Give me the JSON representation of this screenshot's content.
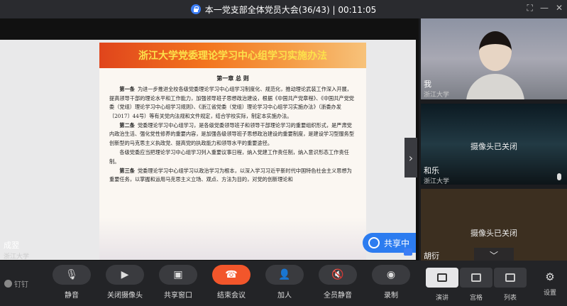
{
  "titlebar": {
    "title": "本一党支部全体党员大会(36/43) | 00:11:05"
  },
  "document": {
    "title": "浙江大学党委理论学习中心组学习实施办法",
    "chapter": "第一章 总 则",
    "paragraphs": [
      {
        "head": "第一条",
        "text": "为进一步推进全校各级党委理论学习中心组学习制度化、规范化，推动理论武装工作深入开展，提高领导干部的理论水平和工作能力，加强领导班子思想政治建设，根据《中国共产党章程》、《中国共产党党委（党组）理论学习中心组学习规则》、《浙江省党委（党组）理论学习中心组学习实施办法》（浙委办发〔2017〕44号）等有关党内法规和文件规定，结合学校实际，制定本实施办法。"
      },
      {
        "head": "第二条",
        "text": "党委理论学习中心组学习，是各级党委领导班子和领导干部理论学习的重要组织形式，是严肃党内政治生活、强化党性修养的重要内容，是加强各级领导班子思想政治建设的重要制度，是建设学习型服务型创新型的马克思主义执政党、提高党的执政能力和领导水平的重要途径。"
      },
      {
        "head": "",
        "text": "各级党委应当把理论学习中心组学习列入重要议事日程，纳入党建工作责任制，纳入意识形态工作责任制。"
      },
      {
        "head": "第三条",
        "text": "党委理论学习中心组学习以政治学习为根本，以深入学习习近平新时代中国特色社会主义思想为重要任务，以掌握和运用马克思主义立场、观点、方法为目的，对党的创新理论和"
      }
    ]
  },
  "share_button": {
    "label": "共享中"
  },
  "presenter": {
    "name": "成翌",
    "org": "浙江大学"
  },
  "participants": [
    {
      "name": "我",
      "org": "浙江大学",
      "camera_off": ""
    },
    {
      "name": "和乐",
      "org": "浙江大学",
      "camera_off": "摄像头已关闭"
    },
    {
      "name": "胡衍",
      "org": "",
      "camera_off": "摄像头已关闭"
    }
  ],
  "toolbar": {
    "pin": "钉钉",
    "mute": "静音",
    "camera_off": "关闭摄像头",
    "share_window": "共享窗口",
    "end_meeting": "结束会议",
    "add_person": "加人",
    "mute_all": "全员静音",
    "record": "录制",
    "view_speaker": "演讲",
    "view_grid": "宫格",
    "view_list": "列表",
    "settings": "设置"
  },
  "colors": {
    "accent": "#2c7cf0",
    "end_call": "#f2562b"
  }
}
